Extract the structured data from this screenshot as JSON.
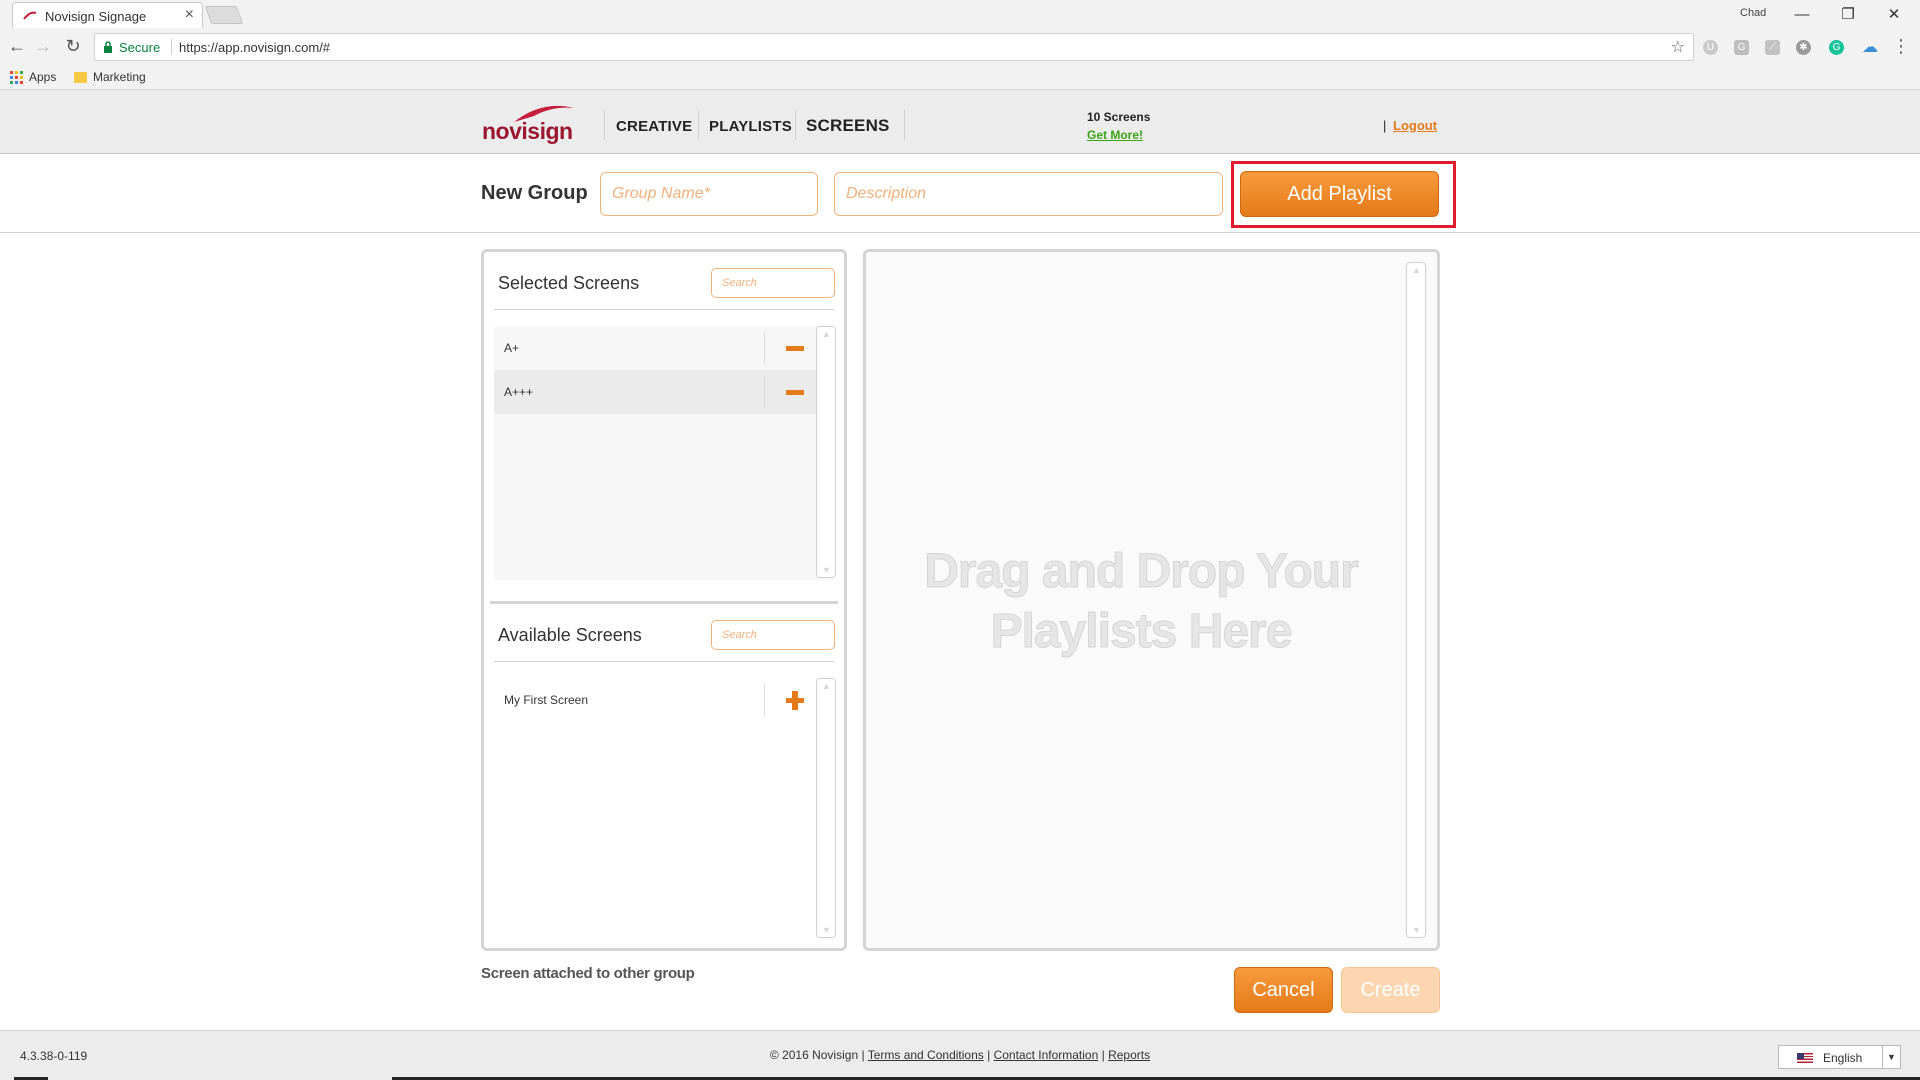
{
  "browser": {
    "tab_title": "Novisign Signage",
    "profile_name": "Chad",
    "secure_label": "Secure",
    "url": "https://app.novisign.com/#",
    "bookmarks": [
      {
        "label": "Apps",
        "icon": "apps-grid-icon"
      },
      {
        "label": "Marketing",
        "icon": "folder-icon"
      }
    ],
    "extensions": [
      "ublock-icon",
      "grammarly-g-icon",
      "pdf-icon",
      "extension-icon",
      "grammarly-icon",
      "cloud-icon"
    ]
  },
  "header": {
    "logo_text": "novisign",
    "menu": [
      {
        "label": "CREATIVE",
        "active": false
      },
      {
        "label": "PLAYLISTS",
        "active": false
      },
      {
        "label": "SCREENS",
        "active": true
      }
    ],
    "screens_count": "10 Screens",
    "get_more": "Get More!",
    "pipe": "|",
    "logout": "Logout"
  },
  "group_form": {
    "title": "New Group",
    "group_name": {
      "value": "",
      "placeholder": "Group Name*"
    },
    "description": {
      "value": "",
      "placeholder": "Description"
    },
    "add_playlist_label": "Add Playlist"
  },
  "selected_screens": {
    "title": "Selected Screens",
    "search_placeholder": "Search",
    "items": [
      {
        "label": "A+",
        "action": "remove"
      },
      {
        "label": "A+++",
        "action": "remove"
      }
    ]
  },
  "available_screens": {
    "title": "Available Screens",
    "search_placeholder": "Search",
    "items": [
      {
        "label": "My First Screen",
        "action": "add"
      }
    ]
  },
  "playlist_drop": {
    "line1": "Drag and Drop Your",
    "line2": "Playlists Here"
  },
  "note": "Screen attached to other group",
  "actions": {
    "cancel": "Cancel",
    "create": "Create"
  },
  "footer": {
    "version": "4.3.38-0-119",
    "copyright": "© 2016 Novisign",
    "links": [
      "Terms and Conditions",
      "Contact Information",
      "Reports"
    ],
    "language": "English"
  },
  "colors": {
    "accent": "#e47a1a",
    "highlight": "#e01b2e",
    "link_green": "#3ca315"
  }
}
